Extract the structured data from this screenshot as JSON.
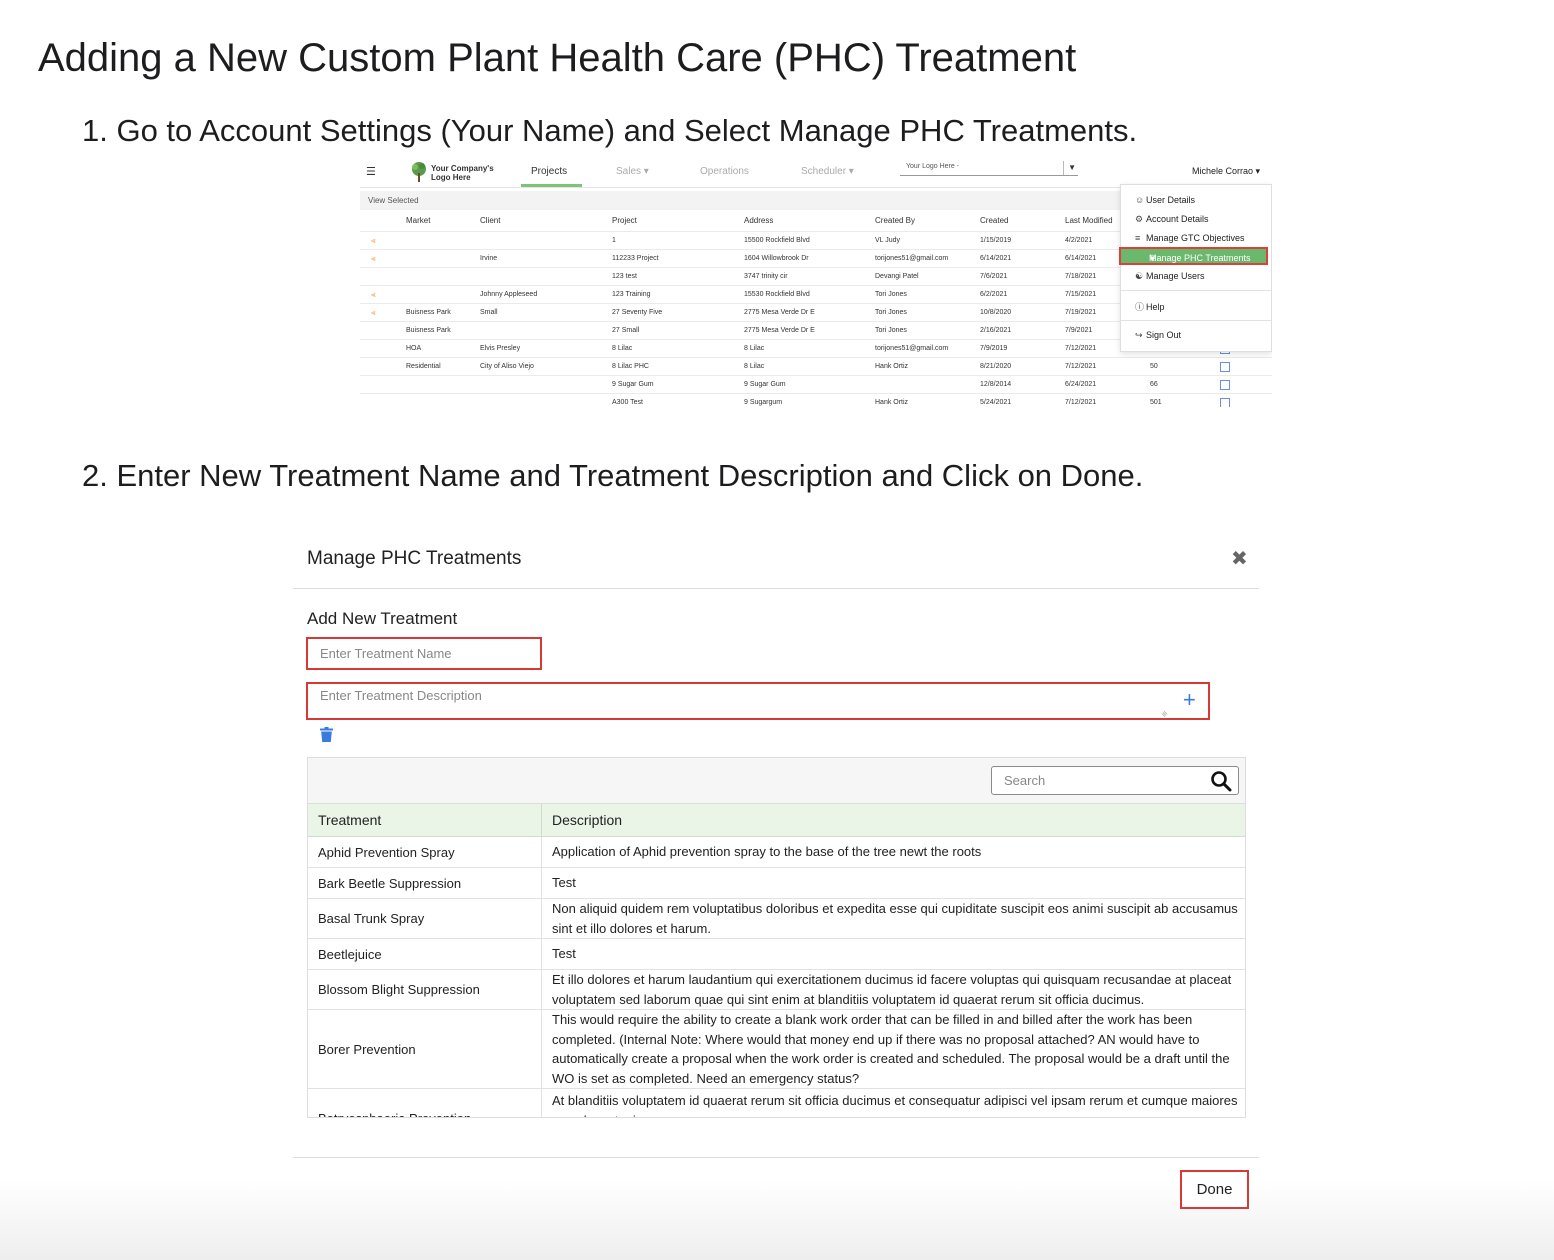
{
  "page": {
    "title": "Adding a New Custom Plant Health Care (PHC) Treatment",
    "step1": "1. Go to Account Settings (Your Name) and Select Manage PHC Treatments.",
    "step2": "2. Enter New Treatment Name and Treatment Description and Click on Done."
  },
  "app_screenshot": {
    "logo_text": "Your Company's Logo Here",
    "nav_tabs": [
      "Projects",
      "Sales",
      "Operations",
      "Scheduler"
    ],
    "logo_select": "Your Logo Here -",
    "user_name": "Michele Corrao",
    "view_selected": "View Selected",
    "columns": [
      "Market",
      "Client",
      "Project",
      "Address",
      "Created By",
      "Created",
      "Last Modified"
    ],
    "rows": [
      {
        "market": "",
        "client": "",
        "project": "1",
        "address": "15500 Rockfield Blvd",
        "created_by": "VL Judy",
        "created": "1/15/2019",
        "modified": "4/2/2021",
        "extra": "",
        "shared": true
      },
      {
        "market": "",
        "client": "Irvine",
        "project": "112233 Project",
        "address": "1604 Willowbrook Dr",
        "created_by": "torijones51@gmail.com",
        "created": "6/14/2021",
        "modified": "6/14/2021",
        "extra": "",
        "shared": true
      },
      {
        "market": "",
        "client": "",
        "project": "123 test",
        "address": "3747 trinity cir",
        "created_by": "Devangi Patel",
        "created": "7/6/2021",
        "modified": "7/18/2021",
        "extra": "",
        "shared": false
      },
      {
        "market": "",
        "client": "Johnny Appleseed",
        "project": "123 Training",
        "address": "15530 Rockfield Blvd",
        "created_by": "Tori Jones",
        "created": "6/2/2021",
        "modified": "7/15/2021",
        "extra": "",
        "shared": true
      },
      {
        "market": "Buisness Park",
        "client": "Small",
        "project": "27 Seventy Five",
        "address": "2775 Mesa Verde Dr E",
        "created_by": "Tori Jones",
        "created": "10/8/2020",
        "modified": "7/19/2021",
        "extra": "",
        "shared": true
      },
      {
        "market": "Buisness Park",
        "client": "",
        "project": "27 Small",
        "address": "2775 Mesa Verde Dr E",
        "created_by": "Tori Jones",
        "created": "2/16/2021",
        "modified": "7/9/2021",
        "extra": "",
        "shared": false
      },
      {
        "market": "HOA",
        "client": "Elvis Presley",
        "project": "8 Lilac",
        "address": "8 Lilac",
        "created_by": "torijones51@gmail.com",
        "created": "7/9/2019",
        "modified": "7/12/2021",
        "extra": "",
        "shared": false
      },
      {
        "market": "Residential",
        "client": "City of Aliso Viejo",
        "project": "8 Lilac PHC",
        "address": "8 Lilac",
        "created_by": "Hank Ortiz",
        "created": "8/21/2020",
        "modified": "7/12/2021",
        "extra": "50",
        "shared": false
      },
      {
        "market": "",
        "client": "",
        "project": "9 Sugar Gum",
        "address": "9 Sugar Gum",
        "created_by": "",
        "created": "12/8/2014",
        "modified": "6/24/2021",
        "extra": "66",
        "shared": false
      },
      {
        "market": "",
        "client": "",
        "project": "A300 Test",
        "address": "9 Sugargum",
        "created_by": "Hank Ortiz",
        "created": "5/24/2021",
        "modified": "7/12/2021",
        "extra": "501",
        "shared": false
      }
    ],
    "user_menu": {
      "items": [
        "User Details",
        "Account Details",
        "Manage GTC Objectives",
        "Manage PHC Treatments",
        "Manage Users",
        "Help",
        "Sign Out"
      ],
      "selected": "Manage PHC Treatments",
      "highlight_color": "#6ab86c"
    }
  },
  "modal": {
    "title": "Manage PHC Treatments",
    "add_heading": "Add New Treatment",
    "name_placeholder": "Enter Treatment Name",
    "description_placeholder": "Enter Treatment Description",
    "search_placeholder": "Search",
    "columns": [
      "Treatment",
      "Description"
    ],
    "rows": [
      {
        "name": "Aphid Prevention Spray",
        "description": "Application of Aphid prevention spray to the base of the tree newt the roots"
      },
      {
        "name": "Bark Beetle Suppression",
        "description": "Test"
      },
      {
        "name": "Basal Trunk Spray",
        "description": "Non aliquid quidem rem voluptatibus doloribus et expedita esse qui cupiditate suscipit eos animi suscipit ab accusamus sint et illo dolores et harum."
      },
      {
        "name": "Beetlejuice",
        "description": "Test"
      },
      {
        "name": "Blossom Blight Suppression",
        "description": "Et illo dolores et harum laudantium qui exercitationem ducimus id facere voluptas qui quisquam recusandae at placeat voluptatem sed laborum quae qui sint enim at blanditiis voluptatem id quaerat rerum sit officia ducimus."
      },
      {
        "name": "Borer Prevention",
        "description": "This would require the ability to create a blank work order that can be filled in and billed after the work has been completed. (Internal Note: Where would that money end up if there was no proposal attached? AN would have to automatically create a proposal when the work order is created and scheduled. The proposal would be a draft until the WO is set as completed. Need an emergency status?"
      },
      {
        "name": "Botryosphaeria Prevention",
        "description": "At blanditiis voluptatem id quaerat rerum sit officia ducimus et consequatur adipisci vel ipsam rerum et cumque maiores eos placeat minus"
      }
    ],
    "done_label": "Done",
    "annotation_color": "#d73a35",
    "header_bg": "#eaf5e8"
  }
}
